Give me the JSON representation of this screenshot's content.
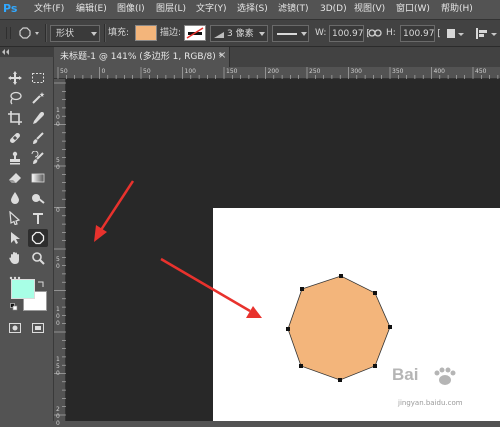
{
  "app": {
    "logo": "Ps"
  },
  "menu": {
    "items": [
      "文件(F)",
      "编辑(E)",
      "图像(I)",
      "图层(L)",
      "文字(Y)",
      "选择(S)",
      "滤镜(T)",
      "3D(D)",
      "视图(V)",
      "窗口(W)",
      "帮助(H)"
    ]
  },
  "options": {
    "mode_value": "形状",
    "fill_label": "填充:",
    "fill_color": "#f3b57b",
    "stroke_label": "描边:",
    "stroke_width": "3 像素",
    "w_label": "W:",
    "w_value": "100.97 [",
    "link_icon": "link-icon",
    "h_label": "H:",
    "h_value": "100.97 ["
  },
  "document": {
    "tab_title": "未标题-1 @ 141% (多边形 1, RGB/8) *",
    "close_glyph": "×"
  },
  "rulers": {
    "h_labels": [
      "100",
      "50",
      "0",
      "50",
      "100",
      "150",
      "200",
      "250",
      "300",
      "350",
      "400",
      "450",
      "500",
      "550",
      "600",
      "650",
      "700"
    ],
    "v_labels": [
      "1\n0\n0",
      "5\n0",
      "0",
      "5\n0",
      "1\n0\n0",
      "1\n5\n0",
      "2\n0\n0"
    ]
  },
  "colors": {
    "foreground": "#a8ffe6",
    "background": "#ffffff",
    "shape_fill": "#f3b57b",
    "accent": "#31a8ff",
    "arrow": "#e8322d"
  },
  "watermark": {
    "site": "Bai",
    "sub": "jingyan.baidu.com"
  }
}
